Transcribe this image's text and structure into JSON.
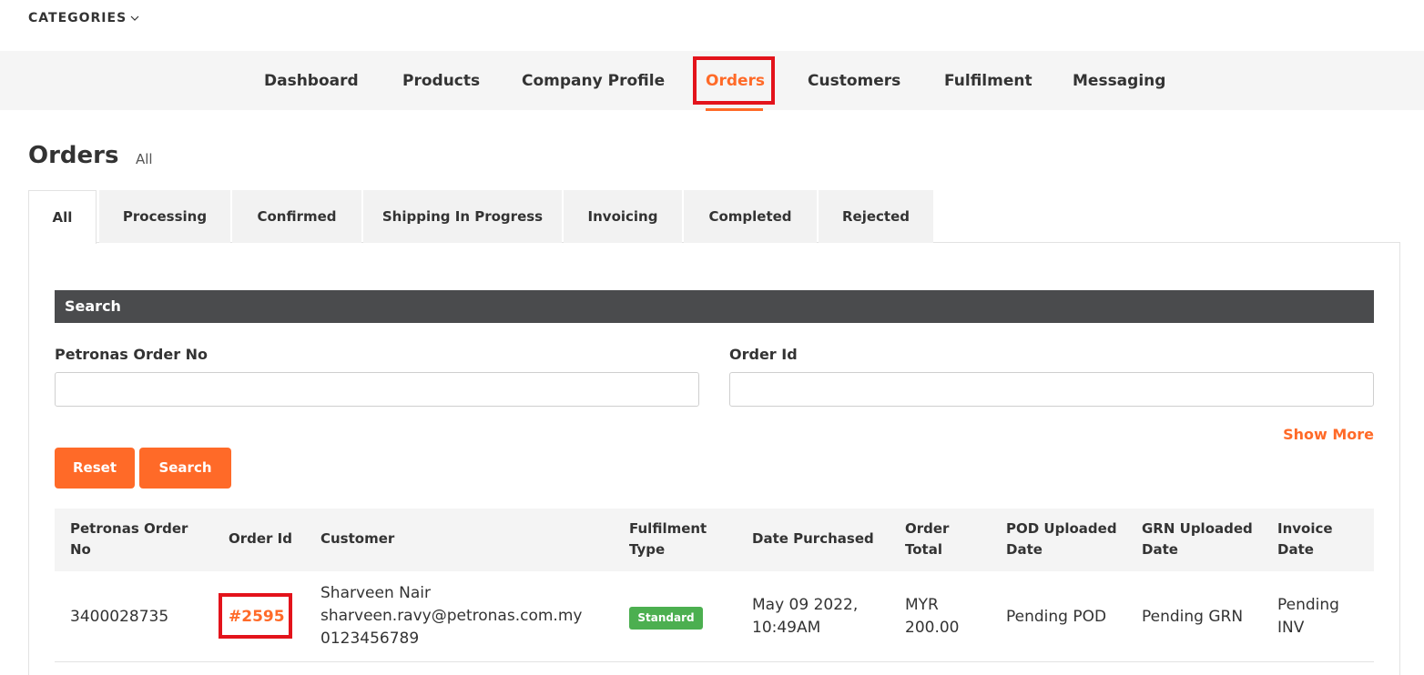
{
  "header": {
    "categories_label": "CATEGORIES"
  },
  "nav": {
    "items": [
      {
        "label": "Dashboard"
      },
      {
        "label": "Products"
      },
      {
        "label": "Company Profile"
      },
      {
        "label": "Orders",
        "active": true
      },
      {
        "label": "Customers"
      },
      {
        "label": "Fulfilment"
      },
      {
        "label": "Messaging"
      }
    ]
  },
  "page": {
    "title": "Orders",
    "subtitle": "All"
  },
  "tabs": [
    {
      "label": "All",
      "active": true
    },
    {
      "label": "Processing"
    },
    {
      "label": "Confirmed"
    },
    {
      "label": "Shipping In Progress"
    },
    {
      "label": "Invoicing"
    },
    {
      "label": "Completed"
    },
    {
      "label": "Rejected"
    }
  ],
  "search": {
    "section_title": "Search",
    "petronas_order_label": "Petronas Order No",
    "petronas_order_value": "",
    "order_id_label": "Order Id",
    "order_id_value": "",
    "show_more": "Show More",
    "reset_label": "Reset",
    "search_label": "Search"
  },
  "table": {
    "headers": [
      {
        "line1": "Petronas Order",
        "line2": "No"
      },
      {
        "line1": "Order Id",
        "line2": ""
      },
      {
        "line1": "Customer",
        "line2": ""
      },
      {
        "line1": "Fulfilment",
        "line2": "Type"
      },
      {
        "line1": "Date Purchased",
        "line2": ""
      },
      {
        "line1": "Order",
        "line2": "Total"
      },
      {
        "line1": "POD Uploaded",
        "line2": "Date"
      },
      {
        "line1": "GRN Uploaded",
        "line2": "Date"
      },
      {
        "line1": "Invoice",
        "line2": "Date"
      }
    ],
    "rows": [
      {
        "petronas_order_no": "3400028735",
        "order_id": "#2595",
        "customer_name": "Sharveen Nair",
        "customer_email": "sharveen.ravy@petronas.com.my",
        "customer_phone": "0123456789",
        "fulfilment_type": "Standard",
        "date_line1": "May 09 2022,",
        "date_line2": "10:49AM",
        "total_line1": "MYR",
        "total_line2": "200.00",
        "pod_date": "Pending POD",
        "grn_date": "Pending GRN",
        "invoice_line1": "Pending",
        "invoice_line2": "INV"
      }
    ]
  },
  "colors": {
    "accent": "#ff6a28",
    "highlight_box": "#e3131b",
    "search_bar_bg": "#4a4b4d",
    "badge_green": "#4caf50"
  }
}
